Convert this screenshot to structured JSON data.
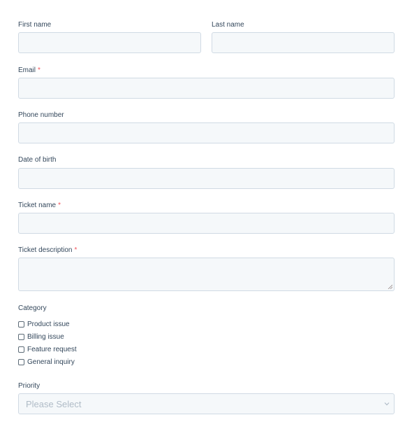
{
  "fields": {
    "first_name": {
      "label": "First name",
      "value": ""
    },
    "last_name": {
      "label": "Last name",
      "value": ""
    },
    "email": {
      "label": "Email",
      "required_mark": "*",
      "value": ""
    },
    "phone": {
      "label": "Phone number",
      "value": ""
    },
    "dob": {
      "label": "Date of birth",
      "value": ""
    },
    "ticket_name": {
      "label": "Ticket name",
      "required_mark": "*",
      "value": ""
    },
    "ticket_description": {
      "label": "Ticket description",
      "required_mark": "*",
      "value": ""
    }
  },
  "category": {
    "label": "Category",
    "options": [
      {
        "label": "Product issue",
        "checked": false
      },
      {
        "label": "Billing issue",
        "checked": false
      },
      {
        "label": "Feature request",
        "checked": false
      },
      {
        "label": "General inquiry",
        "checked": false
      }
    ]
  },
  "priority": {
    "label": "Priority",
    "placeholder": "Please Select",
    "icon": "chevron-down-icon"
  },
  "colors": {
    "input_bg": "#f5f8fa",
    "input_border": "#cbd6e2",
    "label": "#33475b",
    "required": "#f2545b",
    "placeholder": "#a8b5c2"
  }
}
